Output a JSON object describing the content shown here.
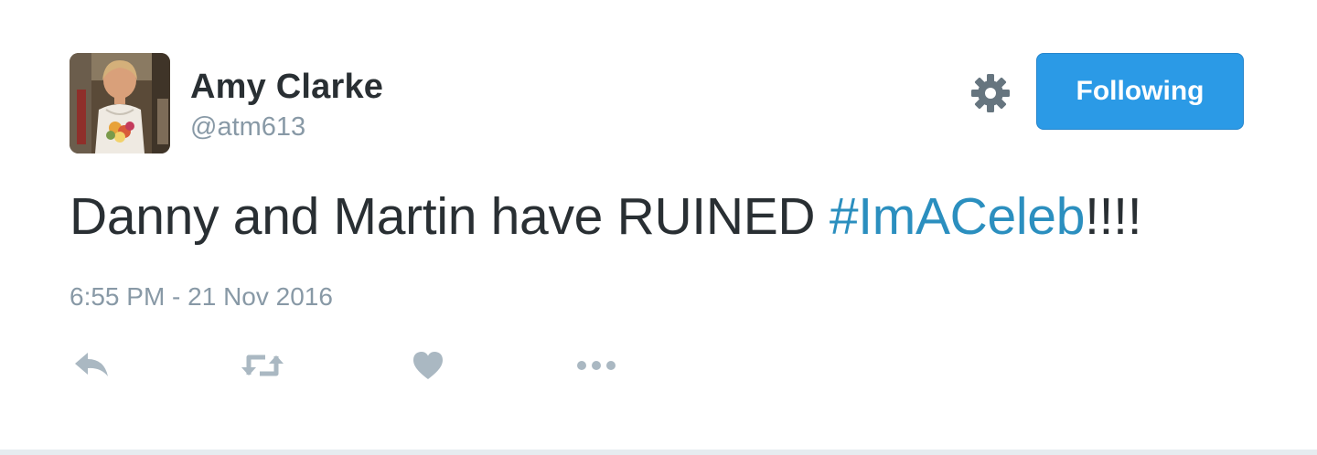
{
  "user": {
    "name": "Amy Clarke",
    "handle": "@atm613"
  },
  "follow_button": {
    "label": "Following"
  },
  "tweet": {
    "text_before": "Danny and Martin have RUINED ",
    "hashtag": "#ImACeleb",
    "text_after": "!!!!",
    "timestamp": "6:55 PM - 21 Nov 2016"
  },
  "icons": {
    "settings": "gear-icon",
    "reply": "reply-icon",
    "retweet": "retweet-icon",
    "like": "heart-icon",
    "more": "more-dots-icon"
  },
  "colors": {
    "name": "#292f33",
    "secondary": "#8899a6",
    "hashtag": "#2b8fbf",
    "button": "#2b9ae6",
    "icon_dark": "#66757f",
    "icon_light": "#aab8c2"
  }
}
